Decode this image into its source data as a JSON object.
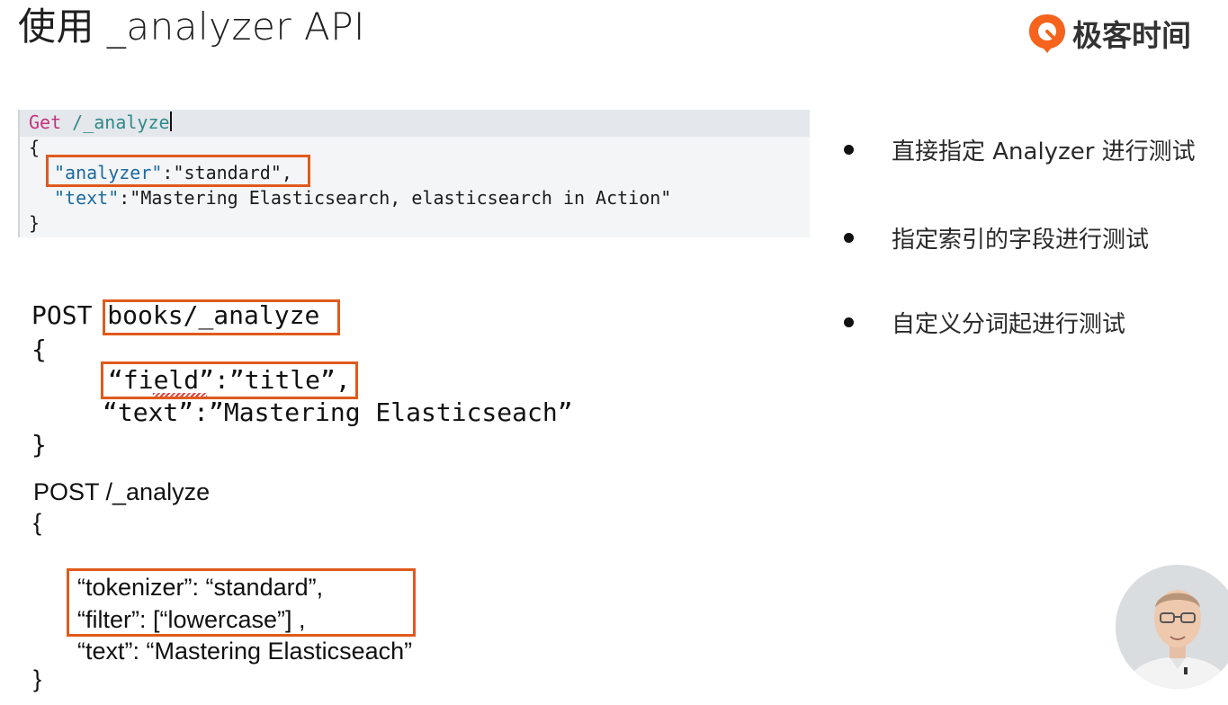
{
  "slide": {
    "title": "使用 _analyzer API"
  },
  "brand": {
    "name": "极客时间",
    "logo_icon": "geektime-logo-icon",
    "color": "#f5631d"
  },
  "console_example": {
    "method": "Get",
    "path": "/_analyze",
    "open_brace": "{",
    "analyzer_key": "\"analyzer\"",
    "colon": ":",
    "analyzer_value": "\"standard\"",
    "comma": ",",
    "text_key": "\"text\"",
    "text_value": "\"Mastering Elasticsearch, elasticsearch in Action\"",
    "close_brace": "}"
  },
  "example_field": {
    "method": "POST",
    "path": "books/_analyze",
    "open_brace": "{",
    "field_line_part1": "“",
    "field_word": "field",
    "field_line_part2": "”:”title”,",
    "text_line": "“text”:”Mastering Elasticseach”",
    "close_brace": "}"
  },
  "example_custom": {
    "request_line": "POST /_analyze",
    "open_brace": "{",
    "tokenizer_line": "“tokenizer”: “standard”,",
    "filter_line": "“filter”: [“lowercase”] ,",
    "text_line": "“text”: “Mastering Elasticseach”",
    "close_brace": "}"
  },
  "bullets": [
    "直接指定 Analyzer 进行测试",
    "指定索引的字段进行测试",
    "自定义分词起进行测试"
  ],
  "highlight_color": "#e05a1c",
  "presenter": {
    "icon": "presenter-avatar-icon"
  }
}
